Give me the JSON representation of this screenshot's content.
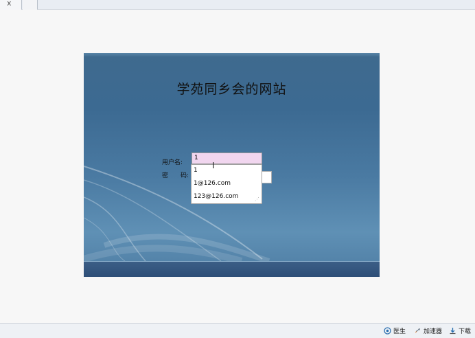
{
  "browser": {
    "tab_close": "x"
  },
  "page": {
    "title": "学苑同乡会的网站",
    "username_label": "用户名:",
    "password_label": "密　　码:",
    "username_value": "1",
    "autocomplete": [
      "1",
      "1@126.com",
      "123@126.com"
    ]
  },
  "statusbar": {
    "doctor": "医生",
    "accelerator": "加速器",
    "download": "下载"
  },
  "icons": {
    "cursor": "text-cursor-icon",
    "doctor": "doctor-icon",
    "accelerator": "rocket-icon",
    "download": "download-icon"
  }
}
